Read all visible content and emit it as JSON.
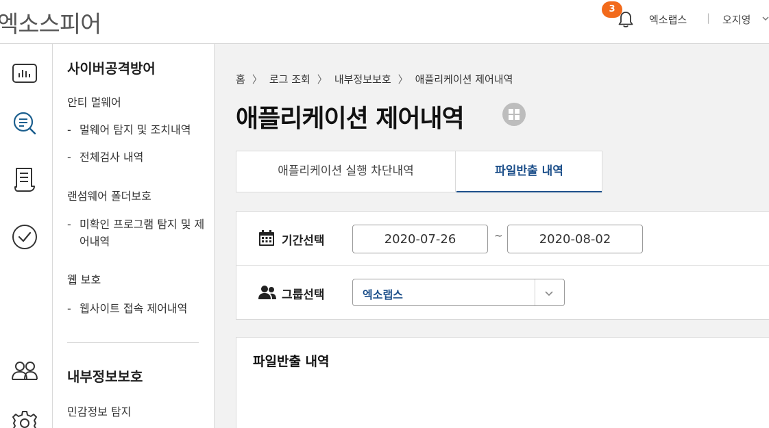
{
  "header": {
    "brand": "엑소스피어",
    "notification_count": "3",
    "org": "엑소랩스",
    "separator": "|",
    "user": "오지영"
  },
  "rail": {
    "icons": [
      "dashboard-icon",
      "search-log-icon",
      "report-icon",
      "check-icon",
      "users-icon",
      "settings-icon"
    ],
    "accent_color": "#1c5f8e"
  },
  "subnav": {
    "section1_title": "사이버공격방어",
    "groups": [
      {
        "label": "안티 멀웨어",
        "items": [
          "멀웨어 탐지 및 조치내역",
          "전체검사 내역"
        ]
      },
      {
        "label": "랜섬웨어 폴더보호",
        "items": [
          "미확인 프로그램 탐지 및 제어내역"
        ]
      },
      {
        "label": "웹 보호",
        "items": [
          "웹사이트 접속 제어내역"
        ]
      }
    ],
    "section2_title": "내부정보보호",
    "section2_items": [
      "민감정보 탐지"
    ],
    "dash": "-"
  },
  "breadcrumb": [
    "홈",
    "로그 조회",
    "내부정보보호",
    "애플리케이션 제어내역"
  ],
  "page_title": "애플리케이션 제어내역",
  "tabs": [
    "애플리케이션 실행 차단내역",
    "파일반출 내역"
  ],
  "filter": {
    "period_label": "기간선택",
    "start_date": "2020-07-26",
    "tilde": "~",
    "end_date": "2020-08-02",
    "group_label": "그룹선택",
    "group_value": "엑소랩스"
  },
  "results": {
    "title": "파일반출 내역"
  },
  "colors": {
    "active_tab": "#1c4f8a",
    "badge": "#f26a1b",
    "background": "#f2f2f2"
  }
}
